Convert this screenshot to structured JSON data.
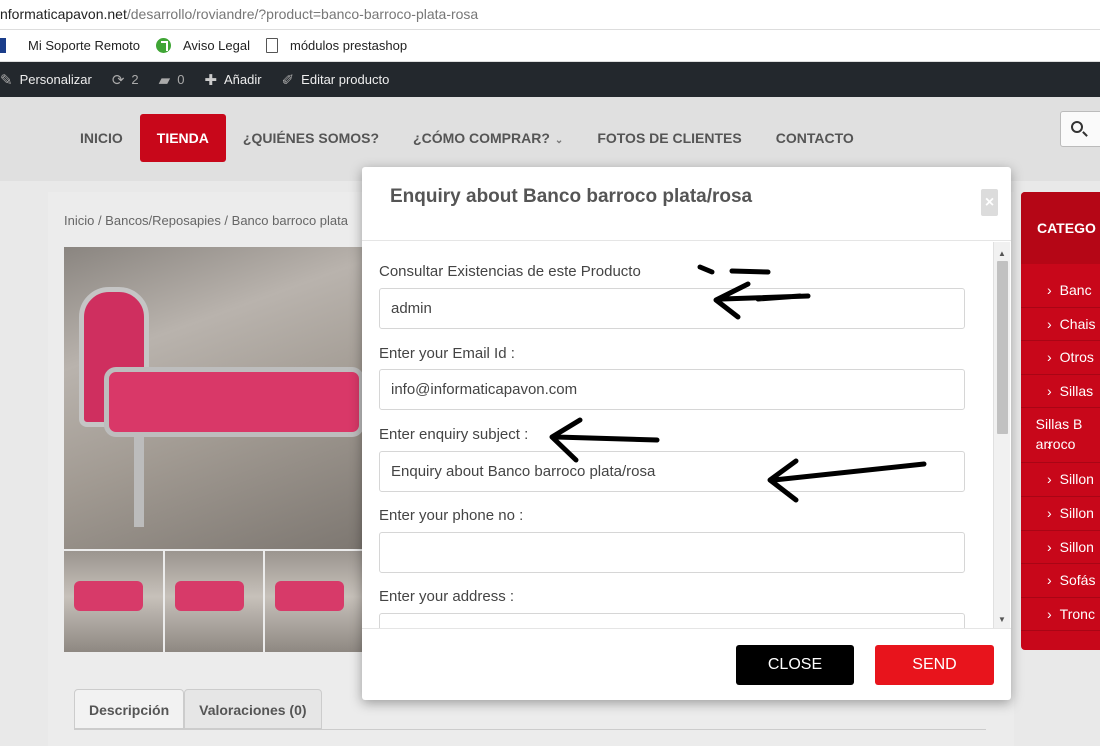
{
  "browser": {
    "url_host": "nformaticapavon.net",
    "url_path": "/desarrollo/roviandre/?product=banco-barroco-plata-rosa",
    "bookmarks": [
      {
        "label": "Mi Soporte Remoto",
        "icon": "remote-support-icon"
      },
      {
        "label": "Aviso Legal",
        "icon": "green-check-icon"
      },
      {
        "label": "módulos prestashop",
        "icon": "page-icon"
      }
    ]
  },
  "admin_bar": {
    "customize": "Personalizar",
    "updates_count": "2",
    "comments_count": "0",
    "add_new": "Añadir",
    "edit_product": "Editar producto"
  },
  "nav": {
    "items": [
      "INICIO",
      "TIENDA",
      "¿QUIÉNES SOMOS?",
      "¿CÓMO COMPRAR?",
      "FOTOS DE CLIENTES",
      "CONTACTO"
    ],
    "active": "TIENDA"
  },
  "page": {
    "breadcrumb": "Inicio / Bancos/Reposapies / Banco barroco plata",
    "tabs": [
      "Descripción",
      "Valoraciones (0)"
    ]
  },
  "sidebar": {
    "title": "CATEGO",
    "items": [
      "Banc",
      "Chais",
      "Otros",
      "Sillas",
      "Sillas Barroco",
      "Sillon",
      "Sillon",
      "Sillon",
      "Sofás",
      "Tronc"
    ]
  },
  "modal": {
    "title": "Enquiry about Banco barroco plata/rosa",
    "close_x": "×",
    "fields": [
      {
        "label": "Consultar Existencias de este Producto",
        "value": "admin"
      },
      {
        "label": "Enter your Email Id :",
        "value": "info@informaticapavon.com"
      },
      {
        "label": "Enter enquiry subject :",
        "value": "Enquiry about Banco barroco plata/rosa"
      },
      {
        "label": "Enter your phone no :",
        "value": ""
      },
      {
        "label": "Enter your address :",
        "value": ""
      }
    ],
    "close_button": "CLOSE",
    "send_button": "SEND"
  },
  "colors": {
    "brand_red": "#c8071a",
    "send_red": "#e8141c",
    "admin_bar": "#23282d"
  }
}
